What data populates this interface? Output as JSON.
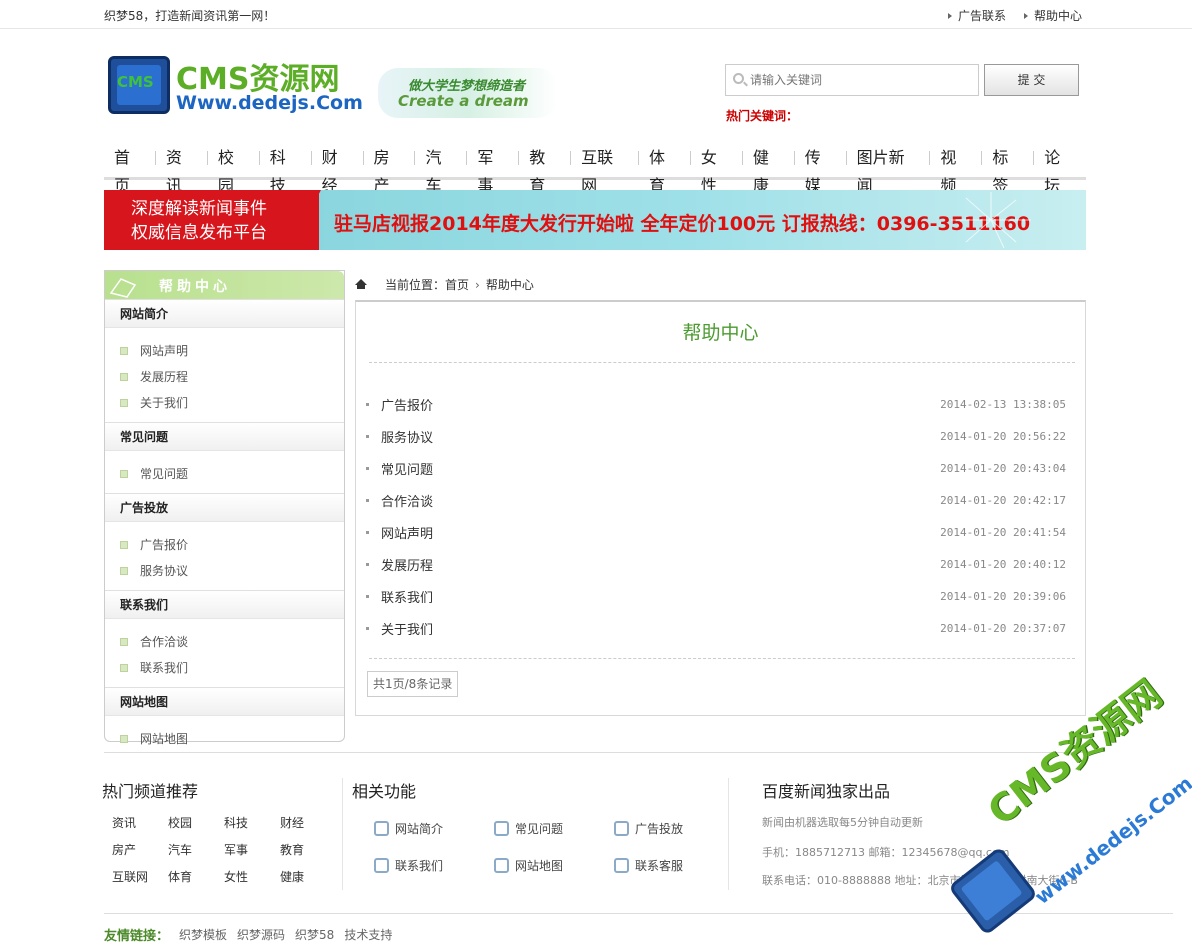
{
  "topbar": {
    "slogan": "织梦58，打造新闻资讯第一网！",
    "links": [
      "广告联系",
      "帮助中心"
    ]
  },
  "logo": {
    "cms": "CMS",
    "line1": "CMS资源网",
    "line2": "Www.dedejs.Com",
    "tag1": "做大学生梦想缔造者",
    "tag2": "Create a dream"
  },
  "search": {
    "placeholder": "请输入关键词",
    "button": "提 交",
    "hot_label": "热门关键词："
  },
  "nav": [
    "首页",
    "资讯",
    "校园",
    "科技",
    "财经",
    "房产",
    "汽车",
    "军事",
    "教育",
    "互联网",
    "体育",
    "女性",
    "健康",
    "传媒",
    "图片新闻",
    "视频",
    "标签",
    "论坛"
  ],
  "banner": {
    "left1": "深度解读新闻事件",
    "left2": "权威信息发布平台",
    "main": "驻马店视报2014年度大发行开始啦  全年定价100元  订报热线：0396-3511160"
  },
  "sidebar": {
    "title": "帮助中心",
    "groups": [
      {
        "title": "网站简介",
        "items": [
          "网站声明",
          "发展历程",
          "关于我们"
        ]
      },
      {
        "title": "常见问题",
        "items": [
          "常见问题"
        ]
      },
      {
        "title": "广告投放",
        "items": [
          "广告报价",
          "服务协议"
        ]
      },
      {
        "title": "联系我们",
        "items": [
          "合作洽谈",
          "联系我们"
        ]
      },
      {
        "title": "网站地图",
        "items": [
          "网站地图"
        ]
      }
    ]
  },
  "breadcrumb": {
    "label": "当前位置：",
    "home": "首页",
    "current": "帮助中心"
  },
  "main": {
    "title": "帮助中心",
    "articles": [
      {
        "name": "广告报价",
        "date": "2014-02-13 13:38:05"
      },
      {
        "name": "服务协议",
        "date": "2014-01-20 20:56:22"
      },
      {
        "name": "常见问题",
        "date": "2014-01-20 20:43:04"
      },
      {
        "name": "合作洽谈",
        "date": "2014-01-20 20:42:17"
      },
      {
        "name": "网站声明",
        "date": "2014-01-20 20:41:54"
      },
      {
        "name": "发展历程",
        "date": "2014-01-20 20:40:12"
      },
      {
        "name": "联系我们",
        "date": "2014-01-20 20:39:06"
      },
      {
        "name": "关于我们",
        "date": "2014-01-20 20:37:07"
      }
    ],
    "pager": "共1页/8条记录"
  },
  "footer": {
    "channels_title": "热门频道推荐",
    "channels": [
      "资讯",
      "校园",
      "科技",
      "财经",
      "房产",
      "汽车",
      "军事",
      "教育",
      "互联网",
      "体育",
      "女性",
      "健康"
    ],
    "functions_title": "相关功能",
    "functions": [
      "网站简介",
      "常见问题",
      "广告投放",
      "联系我们",
      "网站地图",
      "联系客服"
    ],
    "info_title": "百度新闻独家出品",
    "info_lines": [
      "新闻由机器选取每5分钟自动更新",
      "手机：1885712713  邮箱：12345678@qq.com",
      "联系电话：010-8888888  地址：北京市海淀区中关村南大街6-B"
    ],
    "links_title": "友情链接：",
    "links": [
      "织梦模板",
      "织梦源码",
      "织梦58",
      "技术支持"
    ]
  },
  "watermark": {
    "text1": "CMS资源网",
    "text2": "www.dedejs.Com"
  }
}
